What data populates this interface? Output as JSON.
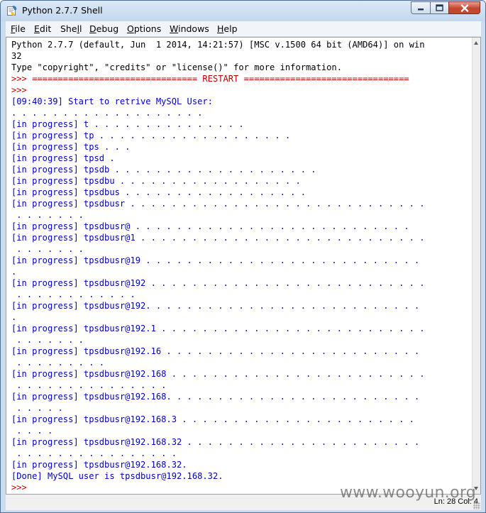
{
  "window": {
    "title": "Python 2.7.7 Shell",
    "icon": "python-shell-icon",
    "controls": [
      "minimize-icon",
      "maximize-icon",
      "close-icon"
    ]
  },
  "menu": {
    "items": [
      {
        "label": "File",
        "accel": "F",
        "rest": "ile"
      },
      {
        "label": "Edit",
        "accel": "E",
        "rest": "dit"
      },
      {
        "label": "Shell",
        "accel": "",
        "pre": "She",
        "accel2": "l",
        "rest": "l"
      },
      {
        "label": "Debug",
        "accel": "D",
        "rest": "ebug"
      },
      {
        "label": "Options",
        "accel": "O",
        "rest": "ptions"
      },
      {
        "label": "Windows",
        "accel": "W",
        "rest": "indows"
      },
      {
        "label": "Help",
        "accel": "H",
        "rest": "elp"
      }
    ]
  },
  "shell": {
    "lines": [
      {
        "text": "Python 2.7.7 (default, Jun  1 2014, 14:21:57) [MSC v.1500 64 bit (AMD64)] on win",
        "color": "black"
      },
      {
        "text": "32",
        "color": "black"
      },
      {
        "text": "Type \"copyright\", \"credits\" or \"license()\" for more information.",
        "color": "black"
      },
      {
        "text": ">>> ================================ RESTART ================================",
        "color": "red"
      },
      {
        "text": ">>> ",
        "color": "red"
      },
      {
        "text": "[09:40:39] Start to retrive MySQL User:",
        "color": "blue"
      },
      {
        "text": ". . . . . . . . . . . . . . . . . . .",
        "color": "blue"
      },
      {
        "text": "[in progress] t . . . . . . . . . . . . . . .",
        "color": "blue"
      },
      {
        "text": "[in progress] tp . . . . . . . . . . . . . . . . . . .",
        "color": "blue"
      },
      {
        "text": "[in progress] tps . . .",
        "color": "blue"
      },
      {
        "text": "[in progress] tpsd .",
        "color": "blue"
      },
      {
        "text": "[in progress] tpsdb . . . . . . . . . . . . . . . . . . . .",
        "color": "blue"
      },
      {
        "text": "[in progress] tpsdbu . . . . . . . . . . . . . . . . . .",
        "color": "blue"
      },
      {
        "text": "[in progress] tpsdbus . . . . . . . . . . . . . . . . . .",
        "color": "blue"
      },
      {
        "text": "[in progress] tpsdbusr . . . . . . . . . . . . . . . . . . . . . . . . . . . . .",
        "color": "blue"
      },
      {
        "text": " . . . . . . .",
        "color": "blue"
      },
      {
        "text": "[in progress] tpsdbusr@ . . . . . . . . . . . . . . . . . . . . . . . . . . .",
        "color": "blue"
      },
      {
        "text": "[in progress] tpsdbusr@1 . . . . . . . . . . . . . . . . . . . . . . . . . . . .",
        "color": "blue"
      },
      {
        "text": " . . . . . . .",
        "color": "blue"
      },
      {
        "text": "[in progress] tpsdbusr@19 . . . . . . . . . . . . . . . . . . . . . . . . . . .",
        "color": "blue"
      },
      {
        "text": ".",
        "color": "blue"
      },
      {
        "text": "[in progress] tpsdbusr@192 . . . . . . . . . . . . . . . . . . . . . . . . . . .",
        "color": "blue"
      },
      {
        "text": " . . . . . . . . . . . .",
        "color": "blue"
      },
      {
        "text": "[in progress] tpsdbusr@192. . . . . . . . . . . . . . . . . . . . . . . . . . .",
        "color": "blue"
      },
      {
        "text": ".",
        "color": "blue"
      },
      {
        "text": "[in progress] tpsdbusr@192.1 . . . . . . . . . . . . . . . . . . . . . . . . . .",
        "color": "blue"
      },
      {
        "text": " . . . . . . .",
        "color": "blue"
      },
      {
        "text": "[in progress] tpsdbusr@192.16 . . . . . . . . . . . . . . . . . . . . . . . . .",
        "color": "blue"
      },
      {
        "text": " . . . . . . . . .",
        "color": "blue"
      },
      {
        "text": "[in progress] tpsdbusr@192.168 . . . . . . . . . . . . . . . . . . . . . . . . .",
        "color": "blue"
      },
      {
        "text": " . . . . . . . . . . . . . . .",
        "color": "blue"
      },
      {
        "text": "[in progress] tpsdbusr@192.168. . . . . . . . . . . . . . . . . . . . . . . . .",
        "color": "blue"
      },
      {
        "text": " . . . . .",
        "color": "blue"
      },
      {
        "text": "[in progress] tpsdbusr@192.168.3 . . . . . . . . . . . . . . . . . . . . . . .",
        "color": "blue"
      },
      {
        "text": " . . . .",
        "color": "blue"
      },
      {
        "text": "[in progress] tpsdbusr@192.168.32 . . . . . . . . . . . . . . . . . . . . . . .",
        "color": "blue"
      },
      {
        "text": " . . . . . . . . . . . . . . . .",
        "color": "blue"
      },
      {
        "text": "[in progress] tpsdbusr@192.168.32.",
        "color": "blue"
      },
      {
        "text": "[Done] MySQL user is tpsdbusr@192.168.32.",
        "color": "blue"
      },
      {
        "text": ">>> ",
        "color": "red"
      }
    ]
  },
  "statusbar": {
    "text": "Ln: 28 Col: 4"
  },
  "watermark": {
    "text": "www.wooyun.org"
  }
}
